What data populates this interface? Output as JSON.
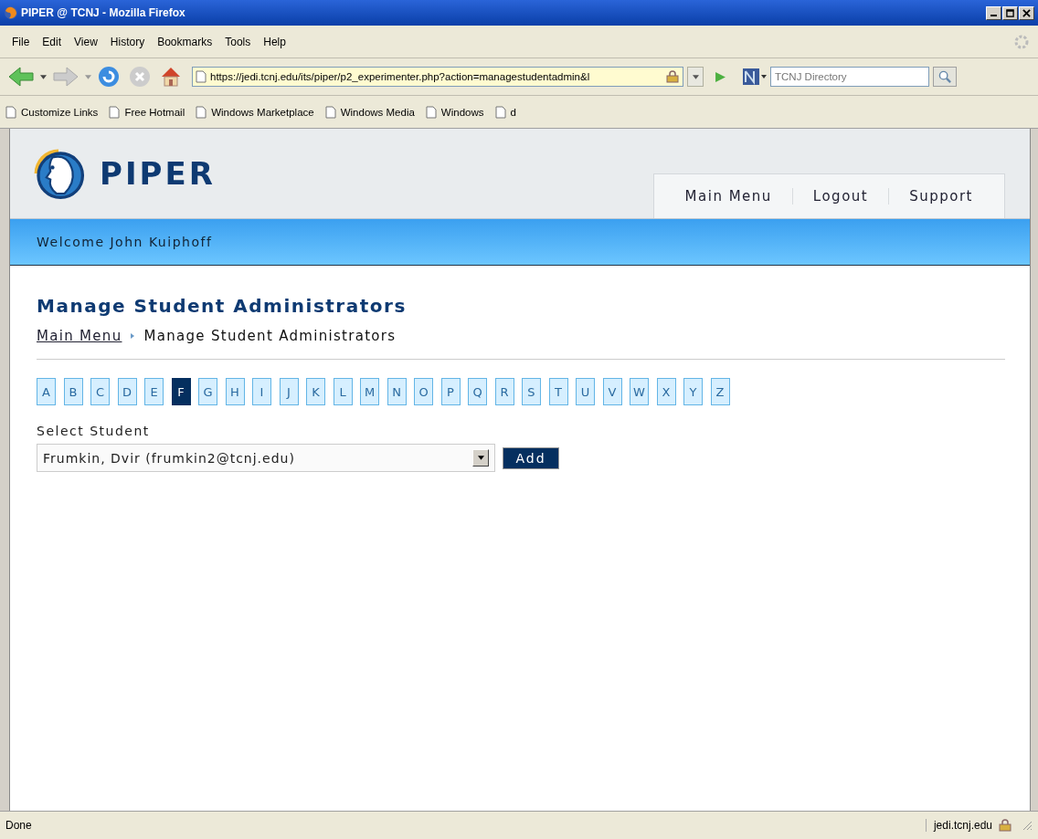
{
  "window": {
    "title": "PIPER @ TCNJ - Mozilla Firefox"
  },
  "menu": [
    "File",
    "Edit",
    "View",
    "History",
    "Bookmarks",
    "Tools",
    "Help"
  ],
  "address": {
    "value": "https://jedi.tcnj.edu/its/piper/p2_experimenter.php?action=managestudentadmin&l"
  },
  "search": {
    "placeholder": "TCNJ Directory"
  },
  "bookmarks": [
    "Customize Links",
    "Free Hotmail",
    "Windows Marketplace",
    "Windows Media",
    "Windows",
    "d"
  ],
  "site": {
    "logo": "PIPER",
    "nav": [
      "Main Menu",
      "Logout",
      "Support"
    ],
    "welcome": "Welcome John Kuiphoff"
  },
  "page": {
    "heading": "Manage Student Administrators",
    "breadcrumb": {
      "link": "Main Menu",
      "current": "Manage Student Administrators"
    },
    "letters": [
      {
        "label": "A",
        "selected": false
      },
      {
        "label": "B",
        "selected": false
      },
      {
        "label": "C",
        "selected": false
      },
      {
        "label": "D",
        "selected": false
      },
      {
        "label": "E",
        "selected": false
      },
      {
        "label": "F",
        "selected": true
      },
      {
        "label": "G",
        "selected": false
      },
      {
        "label": "H",
        "selected": false
      },
      {
        "label": "I",
        "selected": false
      },
      {
        "label": "J",
        "selected": false
      },
      {
        "label": "K",
        "selected": false
      },
      {
        "label": "L",
        "selected": false
      },
      {
        "label": "M",
        "selected": false
      },
      {
        "label": "N",
        "selected": false
      },
      {
        "label": "O",
        "selected": false
      },
      {
        "label": "P",
        "selected": false
      },
      {
        "label": "Q",
        "selected": false
      },
      {
        "label": "R",
        "selected": false
      },
      {
        "label": "S",
        "selected": false
      },
      {
        "label": "T",
        "selected": false
      },
      {
        "label": "U",
        "selected": false
      },
      {
        "label": "V",
        "selected": false
      },
      {
        "label": "W",
        "selected": false
      },
      {
        "label": "X",
        "selected": false
      },
      {
        "label": "Y",
        "selected": false
      },
      {
        "label": "Z",
        "selected": false
      }
    ],
    "select_label": "Select Student",
    "select_value": "Frumkin, Dvir (frumkin2@tcnj.edu)",
    "add_button": "Add"
  },
  "status_bar": {
    "text": "Done",
    "host": "jedi.tcnj.edu"
  }
}
